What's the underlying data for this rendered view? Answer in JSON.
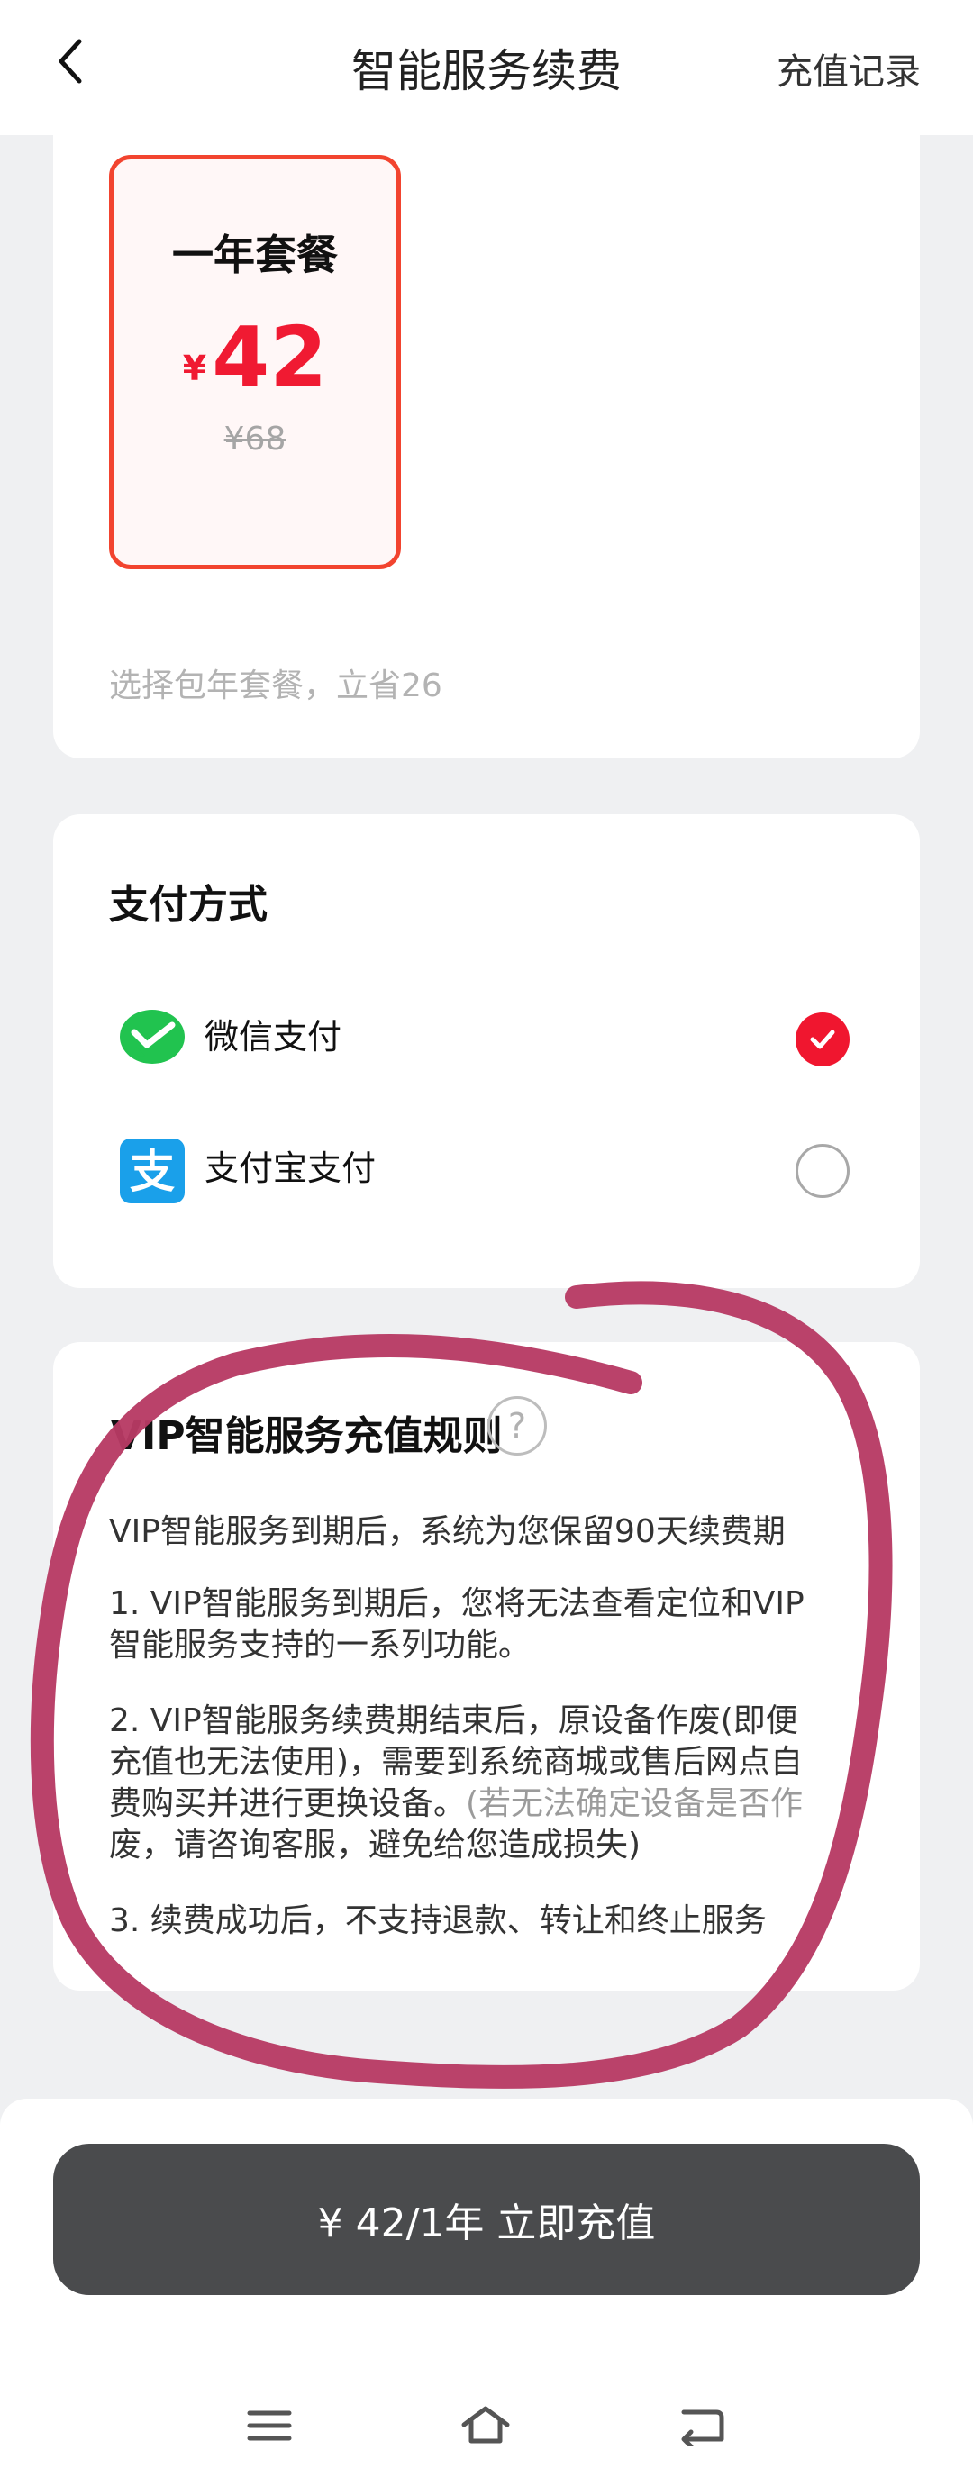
{
  "header": {
    "title": "智能服务续费",
    "link": "充值记录"
  },
  "plan": {
    "name": "一年套餐",
    "currency": "¥",
    "price": "42",
    "original_price": "¥68",
    "hint": "选择包年套餐，立省26"
  },
  "payment": {
    "title": "支付方式",
    "methods": [
      {
        "label": "微信支付",
        "selected": true
      },
      {
        "label": "支付宝支付",
        "selected": false
      }
    ]
  },
  "rules": {
    "title": "VIP智能服务充值规则",
    "help_symbol": "?",
    "intro": "VIP智能服务到期后，系统为您保留90天续费期",
    "item1_line1": "1. VIP智能服务到期后，您将无法查看定位和VIP",
    "item1_line2": "智能服务支持的一系列功能。",
    "item2_line1": "2. VIP智能服务续费期结束后，原设备作废(即便",
    "item2_line2": "充值也无法使用)，需要到系统商城或售后网点自",
    "item2_line3_main": "费购买并进行更换设备。",
    "item2_line3_gray": "(若无法确定设备是否作",
    "item2_line4_gray": "废，请咨询客服，避免给您造成损失)",
    "item3": "3. 续费成功后，不支持退款、转让和终止服务"
  },
  "action": {
    "recharge_label": "¥ 42/1年 立即充值"
  },
  "colors": {
    "accent_red": "#f0162f",
    "plan_border": "#f2442f",
    "button_dark": "#4a4b4d",
    "annotation": "#b73a64",
    "wechat_green": "#21c34f",
    "alipay_blue": "#1aa0ea"
  },
  "icons": {
    "back": "chevron-left-icon",
    "wechat": "wechat-pay-icon",
    "alipay": "alipay-icon",
    "checked": "check-icon",
    "help": "question-mark-icon",
    "nav_menu": "menu-icon",
    "nav_home": "home-icon",
    "nav_back": "return-icon"
  }
}
